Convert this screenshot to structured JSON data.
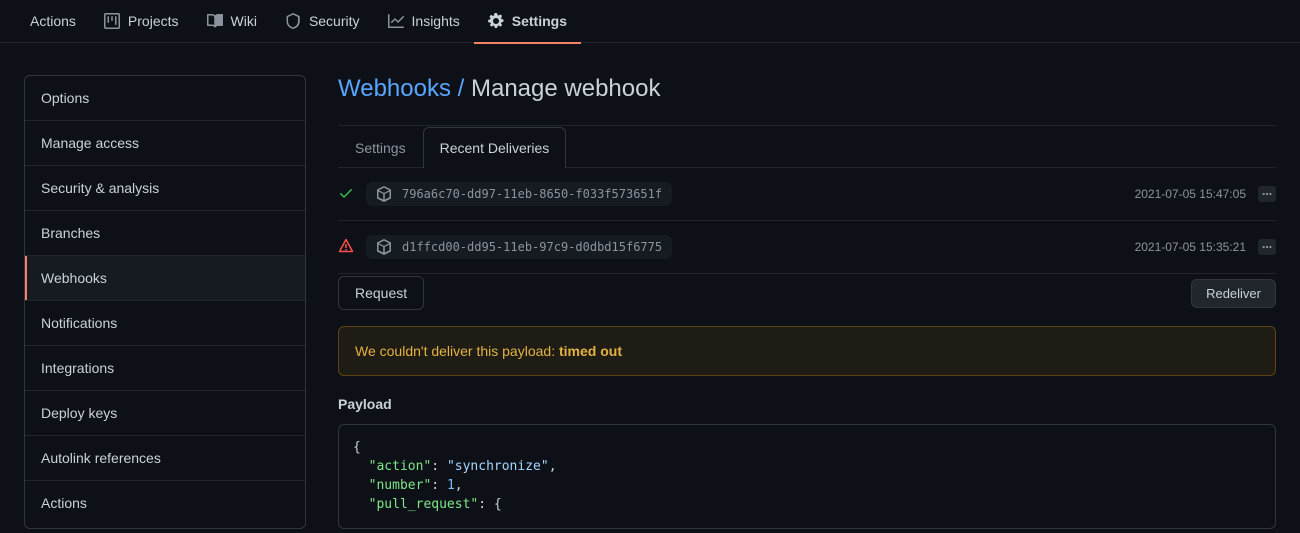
{
  "topnav": {
    "items": [
      {
        "label": "Actions",
        "icon": null
      },
      {
        "label": "Projects",
        "icon": "projects"
      },
      {
        "label": "Wiki",
        "icon": "book"
      },
      {
        "label": "Security",
        "icon": "shield"
      },
      {
        "label": "Insights",
        "icon": "graph"
      },
      {
        "label": "Settings",
        "icon": "gear",
        "active": true
      }
    ]
  },
  "sidebar": {
    "items": [
      {
        "label": "Options"
      },
      {
        "label": "Manage access"
      },
      {
        "label": "Security & analysis"
      },
      {
        "label": "Branches"
      },
      {
        "label": "Webhooks",
        "active": true
      },
      {
        "label": "Notifications"
      },
      {
        "label": "Integrations"
      },
      {
        "label": "Deploy keys"
      },
      {
        "label": "Autolink references"
      },
      {
        "label": "Actions"
      }
    ]
  },
  "breadcrumb": {
    "parent": "Webhooks",
    "separator": "/",
    "current": "Manage webhook"
  },
  "subtabs": {
    "items": [
      {
        "label": "Settings"
      },
      {
        "label": "Recent Deliveries",
        "active": true
      }
    ]
  },
  "deliveries": [
    {
      "status": "ok",
      "id": "796a6c70-dd97-11eb-8650-f033f573651f",
      "time": "2021-07-05 15:47:05"
    },
    {
      "status": "fail",
      "id": "d1ffcd00-dd95-11eb-97c9-d0dbd15f6775",
      "time": "2021-07-05 15:35:21",
      "expanded": true
    }
  ],
  "detail": {
    "request_tab": "Request",
    "redeliver": "Redeliver",
    "alert_prefix": "We couldn't deliver this payload: ",
    "alert_reason": "timed out",
    "payload_title": "Payload",
    "payload_json": {
      "action": "synchronize",
      "number": 1,
      "pull_request": {}
    }
  },
  "icons": {
    "gear": "gear-icon",
    "projects": "projects-icon",
    "book": "book-icon",
    "shield": "shield-icon",
    "graph": "graph-icon",
    "package": "package-icon",
    "check": "check-icon",
    "warn": "warn-icon",
    "kebab": "kebab-icon"
  }
}
